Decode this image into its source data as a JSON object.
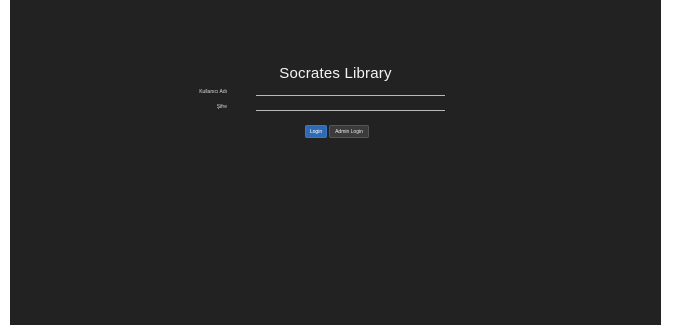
{
  "app": {
    "title": "Socrates Library"
  },
  "form": {
    "username_label": "Kullanıcı Adı",
    "username_value": "",
    "password_label": "Şifre",
    "password_value": ""
  },
  "buttons": {
    "login_label": "Login",
    "admin_login_label": "Admin Login"
  },
  "colors": {
    "background": "#222222",
    "primary_button": "#2f6ab4",
    "secondary_button": "#3b3b3b"
  }
}
